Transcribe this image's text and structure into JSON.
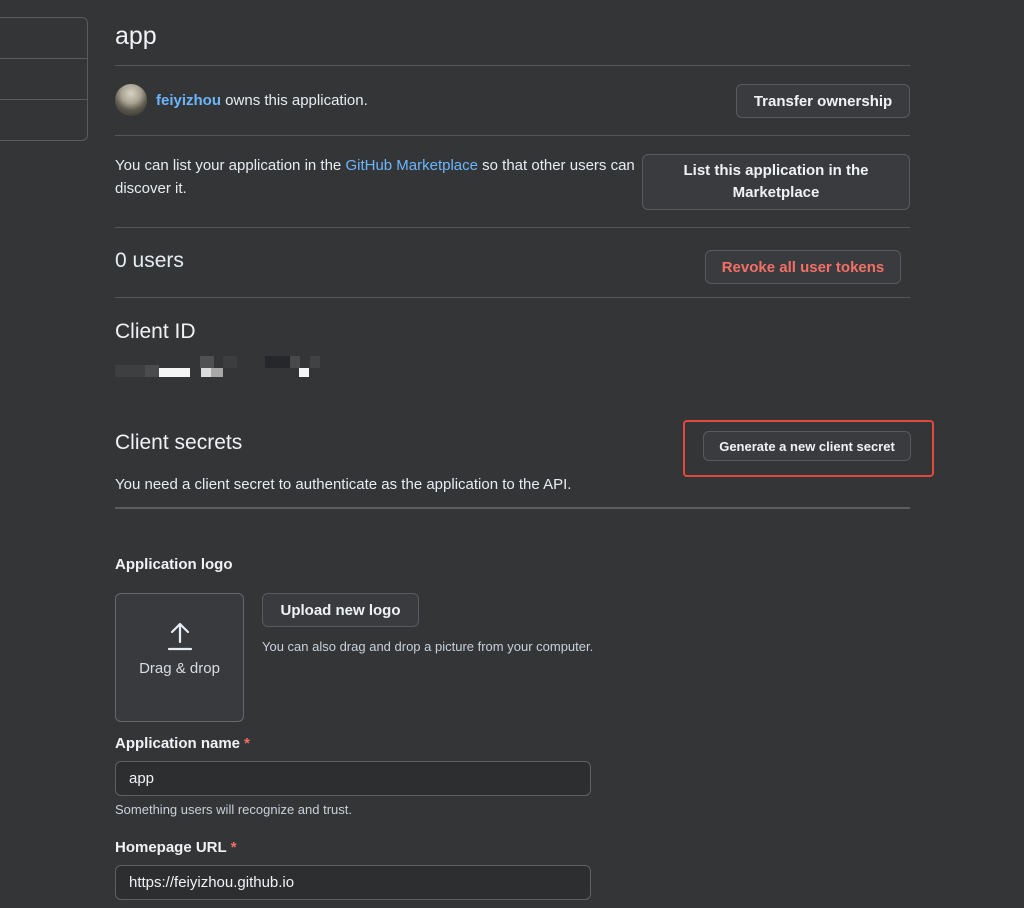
{
  "app": {
    "title": "app"
  },
  "owner": {
    "username": "feiyizhou",
    "suffix": " owns this application.",
    "transfer_button": "Transfer ownership"
  },
  "marketplace": {
    "text_before": "You can list your application in the ",
    "link": "GitHub Marketplace",
    "text_after": " so that other users can discover it.",
    "button_line1": "List this application in the",
    "button_line2": "Marketplace"
  },
  "users": {
    "count_label": "0 users",
    "revoke_button": "Revoke all user tokens"
  },
  "client_id": {
    "title": "Client ID"
  },
  "client_secrets": {
    "title": "Client secrets",
    "generate_button": "Generate a new client secret",
    "description": "You need a client secret to authenticate as the application to the API."
  },
  "logo": {
    "label": "Application logo",
    "dropzone_label": "Drag & drop",
    "upload_button": "Upload new logo",
    "hint": "You can also drag and drop a picture from your computer."
  },
  "app_name": {
    "label": "Application name",
    "required_mark": "*",
    "value": "app",
    "hint": "Something users will recognize and trust."
  },
  "homepage": {
    "label": "Homepage URL",
    "required_mark": "*",
    "value": "https://feiyizhou.github.io"
  },
  "colors": {
    "background": "#343537",
    "link": "#6cb6ff",
    "danger": "#f47067",
    "highlight": "#e2493c"
  }
}
